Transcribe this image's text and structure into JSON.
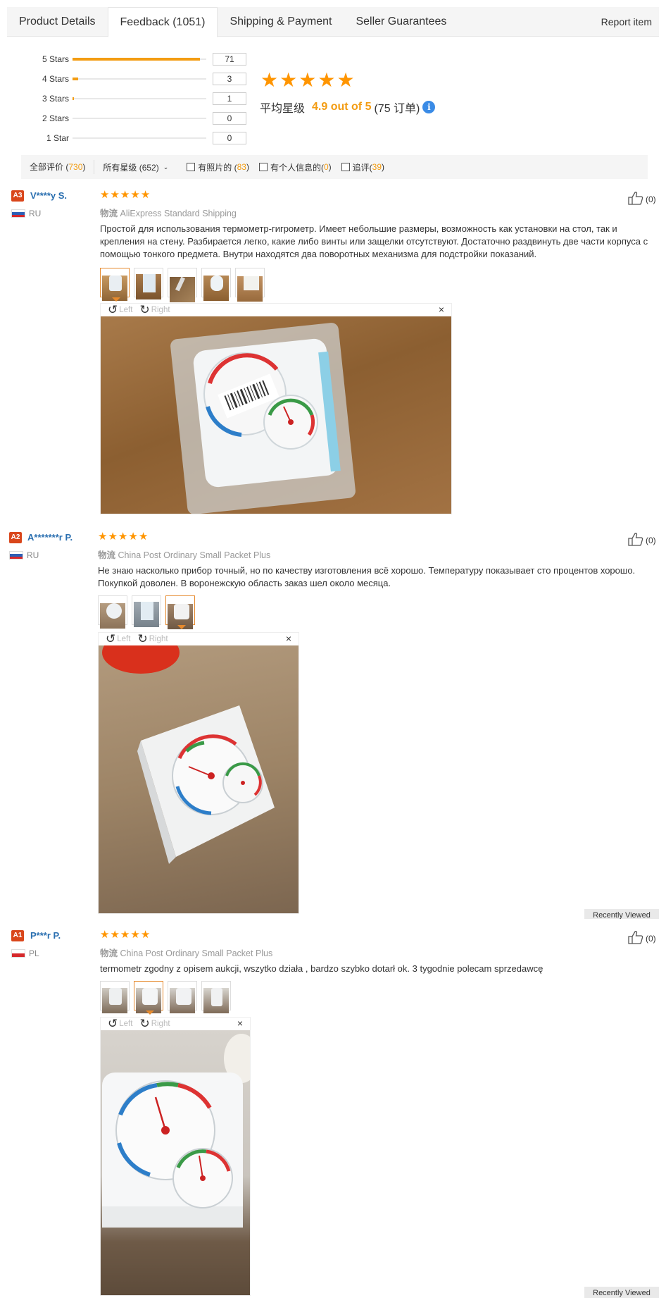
{
  "tabs": {
    "items": [
      "Product Details",
      "Feedback (1051)",
      "Shipping & Payment",
      "Seller Guarantees"
    ],
    "report": "Report item"
  },
  "rating": {
    "rows": [
      {
        "label": "5 Stars",
        "count": "71",
        "fraction": 0.95
      },
      {
        "label": "4 Stars",
        "count": "3",
        "fraction": 0.04
      },
      {
        "label": "3 Stars",
        "count": "1",
        "fraction": 0.01
      },
      {
        "label": "2 Stars",
        "count": "0",
        "fraction": 0
      },
      {
        "label": "1 Star",
        "count": "0",
        "fraction": 0
      }
    ],
    "avg_prefix": "平均星级",
    "avg_value": "4.9 out of 5",
    "orders": "(75 订单)",
    "info_glyph": "i"
  },
  "filters": {
    "all_label": "全部评价 (",
    "all_count": "730",
    "all_close": ")",
    "select_label": "所有星级 (652)",
    "photos_label": "有照片的 (",
    "photos_count": "83",
    "personal_label": "有个人信息的(",
    "personal_count": "0",
    "additional_label": "追评(",
    "additional_count": "39",
    "close": ")"
  },
  "viewer": {
    "left": "Left",
    "right": "Right",
    "close": "×"
  },
  "reviews": [
    {
      "level": "A3",
      "name": "V****y S.",
      "country": "RU",
      "shipping_label": "物流",
      "shipping": "AliExpress Standard Shipping",
      "text": "Простой для использования термометр-гигрометр. Имеет небольшие размеры, возможность как установки на стол, так и крепления на стену. Разбирается легко, какие либо винты или защелки отсутствуют. Достаточно раздвинуть две части корпуса с помощью тонкого предмета. Внутри находятся два поворотных механизма для подстройки показаний.",
      "likes": "(0)"
    },
    {
      "level": "A2",
      "name": "A*******r P.",
      "country": "RU",
      "shipping_label": "物流",
      "shipping": "China Post Ordinary Small Packet Plus",
      "text": "Не знаю насколько прибор точный, но по качеству изготовления всё хорошо. Температуру показывает сто процентов хорошо. Покупкой доволен. В воронежскую область заказ шел около месяца.",
      "likes": "(0)"
    },
    {
      "level": "A1",
      "name": "P***r P.",
      "country": "PL",
      "shipping_label": "物流",
      "shipping": "China Post Ordinary Small Packet Plus",
      "text": "termometr zgodny z opisem aukcji, wszytko działa , bardzo szybko dotarł ok. 3 tygodnie polecam sprzedawcę",
      "likes": "(0)"
    }
  ],
  "recently_viewed": "Recently Viewed",
  "colors": {
    "accent": "#f39c12",
    "star": "#ff9500",
    "name": "#2a6fb0",
    "badge": "#d9461b"
  }
}
